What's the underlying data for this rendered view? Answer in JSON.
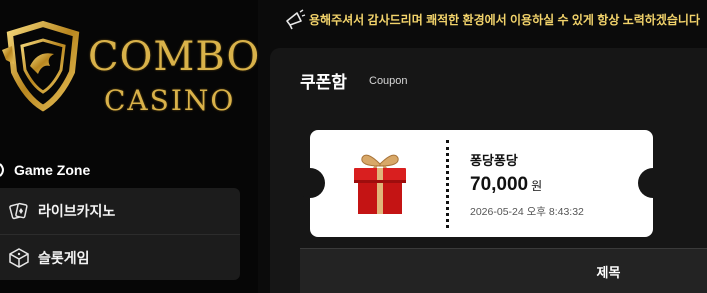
{
  "brand": {
    "line1": "COMBO",
    "line2": "CASINO",
    "gold": "#d9b24a"
  },
  "sidebar": {
    "section_title": "Game Zone",
    "section_icon": "game-zone-icon",
    "items": [
      {
        "label": "라이브카지노",
        "icon": "playing-cards-icon"
      },
      {
        "label": "슬롯게임",
        "icon": "slot-machine-icon"
      }
    ]
  },
  "marquee": {
    "icon": "megaphone-icon",
    "text": "용해주셔서 감사드리며 쾌적한 환경에서 이용하실 수 있게 항상 노력하겠습니다"
  },
  "page": {
    "title": "쿠폰함",
    "subtitle": "Coupon"
  },
  "coupon": {
    "name": "퐁당퐁당",
    "amount": "70,000",
    "unit": "원",
    "date": "2026-05-24 오후 8:43:32",
    "icon": "gift-box-icon"
  },
  "table": {
    "headers": [
      "제목"
    ]
  },
  "colors": {
    "accent_yellow": "#f2d36b",
    "panel": "#161616",
    "menu_bg": "#1c1c1c"
  }
}
